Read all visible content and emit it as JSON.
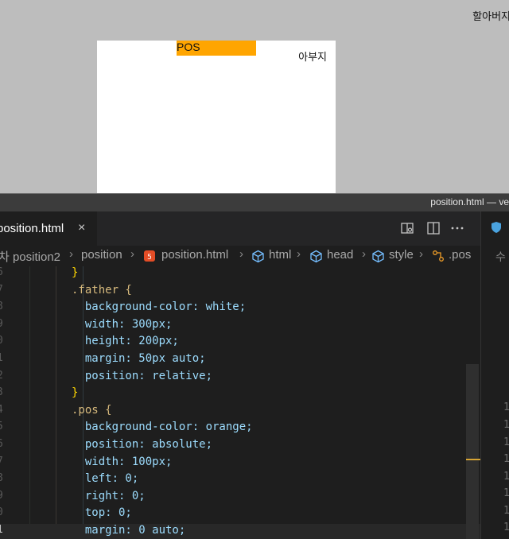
{
  "preview": {
    "grandpa_label": "할아버지",
    "pos_label": "POS",
    "father_label": "아부지"
  },
  "titlebar": {
    "title": "position.html — ve"
  },
  "tabs": {
    "active_label": "position.html",
    "close_icon": "×"
  },
  "breadcrumb": {
    "items": [
      "차 position2",
      "position",
      "position.html",
      "html",
      "head",
      "style",
      ".pos"
    ]
  },
  "editor": {
    "line_numbers": [
      "6",
      "7",
      "8",
      "9",
      "0",
      "1",
      "2",
      "3",
      "4",
      "5",
      "6",
      "7",
      "8",
      "9",
      "0",
      "1"
    ],
    "lines": [
      "}",
      ".father {",
      "  background-color: white;",
      "  width: 300px;",
      "  height: 200px;",
      "  margin: 50px auto;",
      "  position: relative;",
      "}",
      ".pos {",
      "  background-color: orange;",
      "  position: absolute;",
      "  width: 100px;",
      "  left: 0;",
      "  right: 0;",
      "  top: 0;",
      "  margin: 0 auto;"
    ]
  },
  "right_pane": {
    "header": "수",
    "line_numbers": [
      "1",
      "1",
      "1",
      "1",
      "1",
      "1",
      "1",
      "1"
    ]
  },
  "colors": {
    "orange": "#ffa500",
    "white": "#ffffff",
    "editor_bg": "#1e1e1e"
  }
}
